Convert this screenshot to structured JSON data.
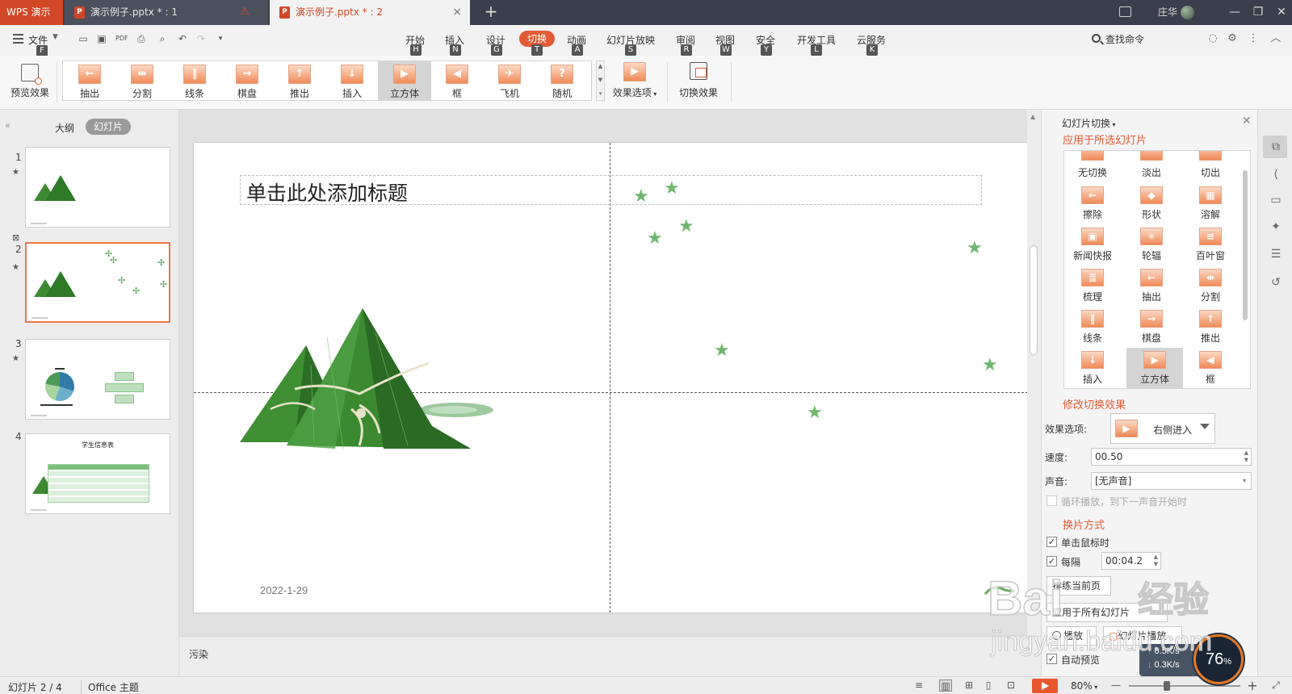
{
  "titlebar": {
    "app_name": "WPS 演示",
    "tabs": [
      {
        "label": "演示例子.pptx * : 1"
      },
      {
        "label": "演示例子.pptx * : 2"
      }
    ],
    "new_tab_label": "+",
    "user_name": "庄华"
  },
  "menubar": {
    "file_label": "文件",
    "file_key": "F",
    "items": [
      {
        "label": "开始",
        "key": "H"
      },
      {
        "label": "插入",
        "key": "N"
      },
      {
        "label": "设计",
        "key": "G"
      },
      {
        "label": "切换",
        "key": "T"
      },
      {
        "label": "动画",
        "key": "A"
      },
      {
        "label": "幻灯片放映",
        "key": "S"
      },
      {
        "label": "审阅",
        "key": "R"
      },
      {
        "label": "视图",
        "key": "W"
      },
      {
        "label": "安全",
        "key": "Y"
      },
      {
        "label": "开发工具",
        "key": "L"
      },
      {
        "label": "云服务",
        "key": "K"
      }
    ],
    "search_label": "查找命令"
  },
  "ribbon": {
    "preview_label": "预览效果",
    "gallery": [
      {
        "label": "抽出",
        "icon": "←"
      },
      {
        "label": "分割",
        "icon": "⇹"
      },
      {
        "label": "线条",
        "icon": "‖"
      },
      {
        "label": "棋盘",
        "icon": "→"
      },
      {
        "label": "推出",
        "icon": "↑"
      },
      {
        "label": "插入",
        "icon": "↓"
      },
      {
        "label": "立方体",
        "icon": "▶"
      },
      {
        "label": "框",
        "icon": "◀"
      },
      {
        "label": "飞机",
        "icon": "✈"
      },
      {
        "label": "随机",
        "icon": "?"
      }
    ],
    "selected_index": 6,
    "effect_options_label": "效果选项",
    "switch_effect_label": "切换效果"
  },
  "left_panel": {
    "tab_outline": "大纲",
    "tab_slides": "幻灯片",
    "slides": [
      {
        "num": "1"
      },
      {
        "num": "2"
      },
      {
        "num": "3"
      },
      {
        "num": "4",
        "title": "学生信息表"
      }
    ],
    "selected_slide": 2
  },
  "slide": {
    "title": "单击此处添加标题",
    "date": "2022-1-29"
  },
  "notes": {
    "text": "污染"
  },
  "right_panel": {
    "title": "幻灯片切换",
    "section_apply": "应用于所选幻灯片",
    "transitions": [
      {
        "label": "无切换",
        "icon": ""
      },
      {
        "label": "淡出",
        "icon": ""
      },
      {
        "label": "切出",
        "icon": ""
      },
      {
        "label": "擦除",
        "icon": "←"
      },
      {
        "label": "形状",
        "icon": "◆"
      },
      {
        "label": "溶解",
        "icon": "▦"
      },
      {
        "label": "新闻快报",
        "icon": "▣"
      },
      {
        "label": "轮辐",
        "icon": "✳"
      },
      {
        "label": "百叶窗",
        "icon": "≡"
      },
      {
        "label": "梳理",
        "icon": "≣"
      },
      {
        "label": "抽出",
        "icon": "←"
      },
      {
        "label": "分割",
        "icon": "⇹"
      },
      {
        "label": "线条",
        "icon": "‖"
      },
      {
        "label": "棋盘",
        "icon": "→"
      },
      {
        "label": "推出",
        "icon": "↑"
      },
      {
        "label": "插入",
        "icon": "↓"
      },
      {
        "label": "立方体",
        "icon": "▶"
      },
      {
        "label": "框",
        "icon": "◀"
      }
    ],
    "selected_transition": 16,
    "section_modify": "修改切换效果",
    "effect_option_label": "效果选项:",
    "effect_option_value": "右侧进入",
    "speed_label": "速度:",
    "speed_value": "00.50",
    "sound_label": "声音:",
    "sound_value": "[无声音]",
    "loop_label": "循环播放，到下一声音开始时",
    "section_advance": "换片方式",
    "on_click_label": "单击鼠标时",
    "every_label": "每隔",
    "every_value": "00:04.2",
    "reset_button_label": "排练当前页",
    "apply_all_label": "应用于所有幻灯片",
    "play_label": "播放",
    "slideshow_label": "幻灯片播放",
    "auto_preview_label": "自动预览"
  },
  "statusbar": {
    "slide_info": "幻灯片 2 / 4",
    "theme": "Office 主题",
    "zoom_level": "80%",
    "zoom_value": 80
  },
  "net_widget": {
    "up_speed": "0.5K/s",
    "down_speed": "0.3K/s",
    "percent": "76",
    "percent_sign": "%"
  },
  "watermark": {
    "brand": "Bai",
    "cn_text": "经验",
    "url": "jingyan.baidu.com"
  },
  "colors": {
    "accent": "#e25b35",
    "titlebar": "#3a3f4b",
    "star": "#6db86d"
  }
}
